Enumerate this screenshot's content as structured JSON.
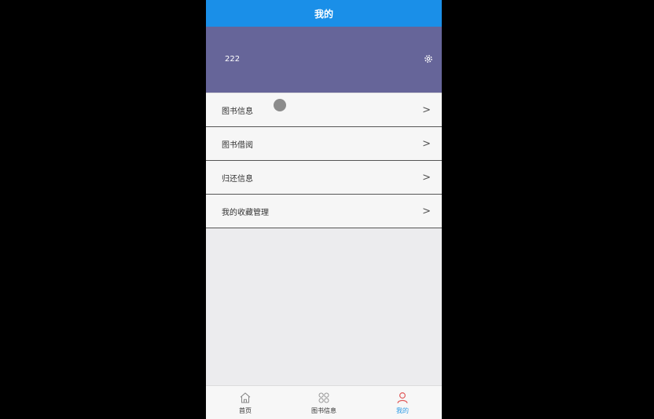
{
  "header": {
    "title": "我的"
  },
  "profile": {
    "username": "222",
    "settings_icon": "gear-icon"
  },
  "menu": {
    "items": [
      {
        "label": "图书信息",
        "chevron": ">"
      },
      {
        "label": "图书借阅",
        "chevron": ">"
      },
      {
        "label": "归还信息",
        "chevron": ">"
      },
      {
        "label": "我的收藏管理",
        "chevron": ">"
      }
    ]
  },
  "tabbar": {
    "items": [
      {
        "label": "首页",
        "icon": "home-icon",
        "active": false
      },
      {
        "label": "图书信息",
        "icon": "grid-icon",
        "active": false
      },
      {
        "label": "我的",
        "icon": "person-icon",
        "active": true
      }
    ]
  },
  "colors": {
    "header_bg": "#1a8fe8",
    "profile_bg": "#666599",
    "active_tab_label": "#2c9be6",
    "active_tab_icon": "#e05a5a"
  }
}
